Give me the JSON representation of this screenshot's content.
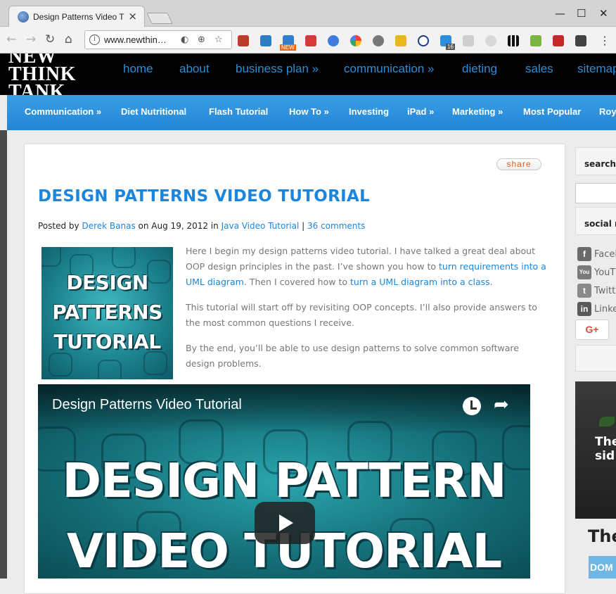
{
  "browser": {
    "tab_title": "Design Patterns Video T",
    "tab_close": "×",
    "url": "www.newthin…",
    "window_controls": {
      "minimize": "—",
      "maximize": "☐",
      "close": "✕"
    },
    "ext_badges": {
      "new": "NEW",
      "count": "16"
    }
  },
  "site": {
    "logo_lines": [
      "NEW",
      "THINK",
      "TANK"
    ],
    "top_nav": [
      "home",
      "about",
      "business plan »",
      "communication »",
      "dieting",
      "sales",
      "sitemap"
    ],
    "category_nav": [
      "Communication »",
      "Diet Nutritional",
      "Flash Tutorial",
      "How To »",
      "Investing",
      "iPad »",
      "Marketing »",
      "Most Popular",
      "Roy"
    ]
  },
  "post": {
    "share_label": "share",
    "title": "DESIGN PATTERNS VIDEO TUTORIAL",
    "meta": {
      "posted_by": "Posted by",
      "author": "Derek Banas",
      "date_text": "on Aug 19, 2012 in",
      "category": "Java Video Tutorial",
      "separator": "|",
      "comments": "36 comments"
    },
    "thumbnail_lines": [
      "DESIGN",
      "PATTERNS",
      "TUTORIAL"
    ],
    "para1": {
      "text_a": "Here I begin my design patterns video tutorial. I have talked a great deal about OOP design principles in the past. I’ve shown you how to ",
      "link_a": "turn requirements into a UML diagram",
      "text_b": ". Then I covered how to ",
      "link_b": "turn a UML diagram into a class",
      "text_c": "."
    },
    "para2": "This tutorial will start off by revisiting OOP concepts. I’ll also provide answers to the most common questions I receive.",
    "para3": "By the end, you’ll be able to use design patterns to solve common software design problems.",
    "video": {
      "title": "Design Patterns Video Tutorial",
      "big_lines": [
        "DESIGN PATTERN",
        "VIDEO TUTORIAL"
      ]
    }
  },
  "sidebar": {
    "search_label": "search",
    "social_label": "social n",
    "social_links": [
      {
        "label": "Facel",
        "icon": "f",
        "color": "#6a6a6a"
      },
      {
        "label": "YouT",
        "icon": "You",
        "color": "#7a7a7a"
      },
      {
        "label": "Twitt",
        "icon": "t",
        "color": "#8a8a8a"
      },
      {
        "label": "Linke",
        "icon": "in",
        "color": "#5a5a5a"
      }
    ],
    "gplus_label": "G+",
    "ad": {
      "image_text_lines": [
        "The",
        "sid"
      ],
      "headline": "The",
      "thumb_text": "DOM"
    }
  },
  "colors": {
    "link_blue": "#1c86dc",
    "nav_blue": "#2185d6",
    "header_black": "#000000"
  }
}
